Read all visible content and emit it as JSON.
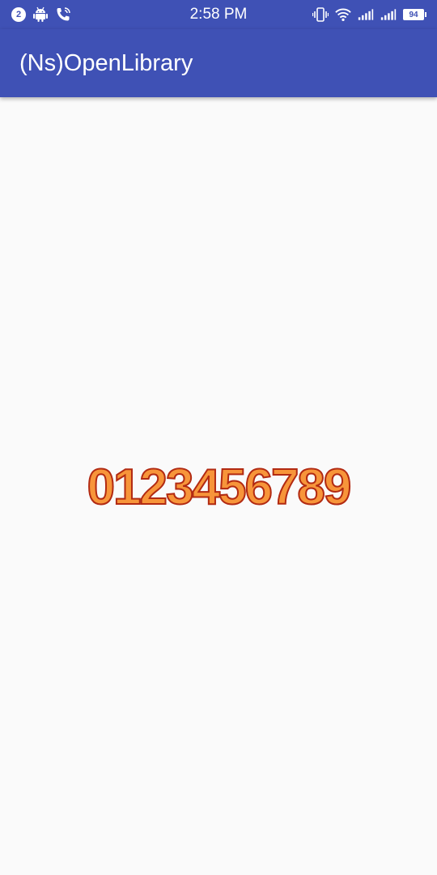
{
  "status_bar": {
    "notification_count": "2",
    "time": "2:58 PM",
    "battery_level": "94",
    "icons": [
      "notification-count-icon",
      "android-icon",
      "phone-call-icon",
      "vibrate-icon",
      "wifi-icon",
      "signal-icon",
      "signal-2-icon",
      "battery-icon"
    ],
    "background": "#3f51b5"
  },
  "app_bar": {
    "title": "(Ns)OpenLibrary",
    "background": "#3f51b5"
  },
  "main": {
    "digits_text": "0123456789",
    "digits_fill": "#f7953a",
    "digits_stroke": "#b22a12"
  }
}
